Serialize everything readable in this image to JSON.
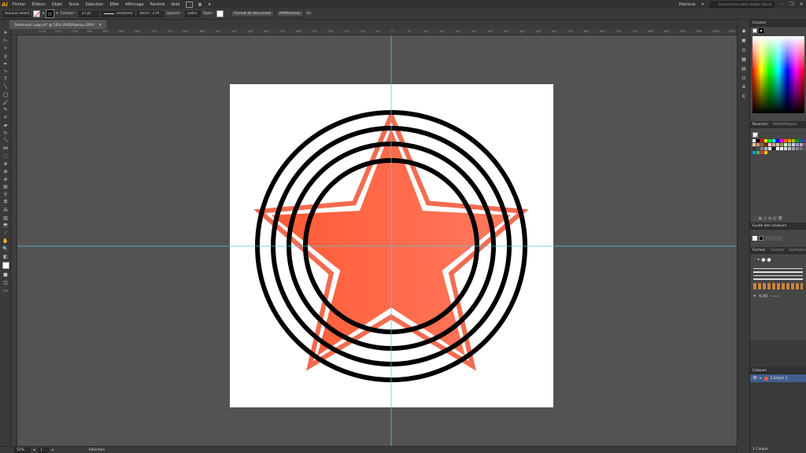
{
  "app": {
    "logo": "Ai",
    "menu": [
      "Fichier",
      "Édition",
      "Objet",
      "Texte",
      "Sélection",
      "Effet",
      "Affichage",
      "Fenêtre",
      "Aide"
    ],
    "workspace": "Peinture",
    "search_placeholder": "Rechercher dans Adobe Stock",
    "window_controls": [
      "–",
      "❐",
      "✕"
    ]
  },
  "control_bar": {
    "selection_label": "Aucune sélection",
    "stroke_label": "Contour :",
    "stroke_value": "25 pt",
    "profile_label": "Uniforme",
    "brush_label": "Rond - 3 Pt",
    "opacity_label": "Opacité :",
    "opacity_value": "100%",
    "style_label": "Style :",
    "doc_format_button": "Format de document",
    "prefs_button": "Préférences"
  },
  "document_tab": {
    "title": "Starmexic Logo.ai* @ 50% (RVB/Aperçu GPU)",
    "close": "✕"
  },
  "ruler_ticks": [
    "-1100",
    "-1050",
    "-1000",
    "-950",
    "-900",
    "-850",
    "-800",
    "-750",
    "-700",
    "-650",
    "-600",
    "-550",
    "-500",
    "-450",
    "-400",
    "-350",
    "-300",
    "-250",
    "-200",
    "-150",
    "-100",
    "-50",
    "0",
    "50",
    "100",
    "150",
    "200",
    "250",
    "300",
    "350",
    "400",
    "450",
    "500",
    "550",
    "600",
    "650",
    "700",
    "750",
    "800",
    "850",
    "900",
    "950",
    "1000",
    "1050",
    "1100"
  ],
  "status_bar": {
    "zoom": "50%",
    "artboard_number": "1",
    "tool_name": "Sélection"
  },
  "panels": {
    "color_tab": "Couleur",
    "swatches_tabs": [
      "Nuancier",
      "Bibliothèques"
    ],
    "color_guide_tab": "Guide des couleurs",
    "brushes_tabs": [
      "Formes",
      "Contour",
      "Symboles"
    ],
    "brush_size_value": "5,00",
    "layers_tab": "Calques",
    "layer_name": "Calque 1",
    "layers_count": "1 Calque"
  },
  "artwork": {
    "star_fill_start": "#ff5a36",
    "star_fill_end": "#ff7a5e",
    "star_outline_color": "#f26b4f",
    "ring_color": "#000000",
    "artboard_color": "#ffffff",
    "guide_color": "#5bc0de"
  },
  "swatch_colors": [
    "#ffffff",
    "#000000",
    "#ff0000",
    "#ffff00",
    "#00ff00",
    "#00ffff",
    "#0000ff",
    "#ff00ff",
    "#ff6600",
    "#ff9900",
    "#99cc00",
    "#009933",
    "#006699",
    "#663399",
    "#cc3366",
    "#996633",
    "#ffcc99",
    "#cc9966",
    "#996633",
    "#663300",
    "#ffcccc",
    "#ff9999",
    "#cccc99",
    "#999966",
    "#ccffcc",
    "#99cc99",
    "#ccccff",
    "#9999cc",
    "#cc99cc",
    "#666666",
    "#999999",
    "#cccccc",
    "#333333",
    "#4d4d4d",
    "#808080",
    "#b3b3b3",
    "#e6e6e6",
    "#1a1a1a",
    "#ffffff",
    "#f2f2f2",
    "#d9d9d9",
    "#bfbfbf",
    "#a6a6a6",
    "#8c8c8c",
    "#737373",
    "#595959",
    "#404040",
    "#262626",
    "#0099ff",
    "#33cc33",
    "#ff3333",
    "#ffcc00"
  ]
}
